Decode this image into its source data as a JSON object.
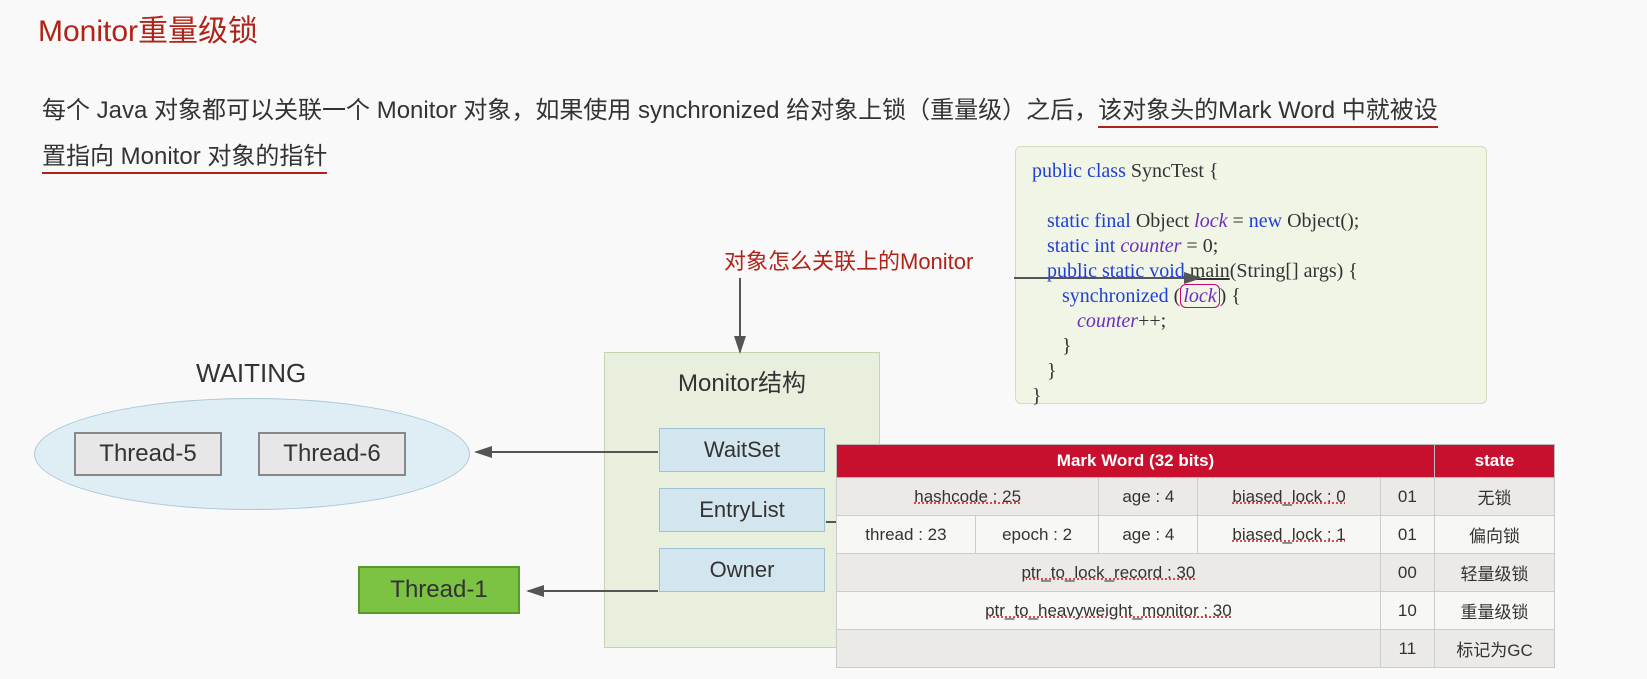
{
  "title": "Monitor重量级锁",
  "desc_prefix": "每个 Java 对象都可以关联一个 Monitor 对象，如果使用 synchronized 给对象上锁（重量级）之后，",
  "desc_ul1": "该对象头的Mark Word 中就被设",
  "desc_ul2": "置指向 Monitor 对象的指针",
  "waiting_label": "WAITING",
  "threads": {
    "t5": "Thread-5",
    "t6": "Thread-6",
    "t1": "Thread-1"
  },
  "monitor": {
    "title": "Monitor结构",
    "waitset": "WaitSet",
    "entrylist": "EntryList",
    "owner": "Owner"
  },
  "annotation": "对象怎么关联上的Monitor",
  "code": {
    "l1a": "public class",
    "l1b": " SyncTest {",
    "l2a": "static final",
    "l2b": " Object ",
    "l2c": "lock",
    "l2d": " = ",
    "l2e": "new",
    "l2f": " Object();",
    "l3a": "static int ",
    "l3b": "counter",
    "l3c": " = 0;",
    "l4a": "public static void ",
    "l4b": "main",
    "l4c": "(String[] args) {",
    "l5a": "synchronized ",
    "l5b": "(",
    "l5c": "lock",
    "l5d": ") {",
    "l6a": "counter",
    "l6b": "++;",
    "l7": "}",
    "l8": "}",
    "l9": "}"
  },
  "mw": {
    "h1": "Mark Word (32 bits)",
    "h2": "state",
    "r1": {
      "c1": "hashcode : 25",
      "c2": "age : 4",
      "c3": "biased_lock : 0",
      "c4": "01",
      "st": "无锁"
    },
    "r2": {
      "c1": "thread : 23",
      "c2": "epoch : 2",
      "c3": "age : 4",
      "c4": "biased_lock : 1",
      "c5": "01",
      "st": "偏向锁"
    },
    "r3": {
      "c1": "ptr_to_lock_record : 30",
      "c4": "00",
      "st": "轻量级锁"
    },
    "r4": {
      "c1": "ptr_to_heavyweight_monitor : 30",
      "c4": "10",
      "st": "重量级锁"
    },
    "r5": {
      "c4": "11",
      "st": "标记为GC"
    }
  }
}
